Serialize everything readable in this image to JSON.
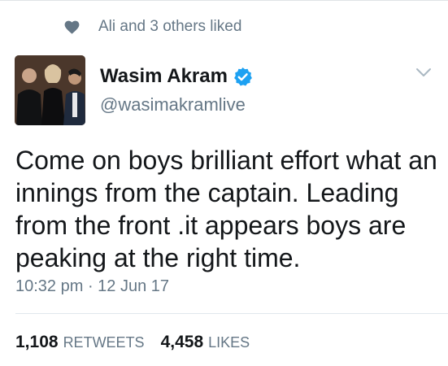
{
  "social_context": {
    "text": "Ali and 3 others liked",
    "icon": "heart-icon"
  },
  "author": {
    "display_name": "Wasim Akram",
    "handle": "@wasimakramlive",
    "verified": true,
    "verified_icon": "verified-badge-icon"
  },
  "tweet": {
    "text": "Come on boys brilliant effort what an innings from the captain. Leading from the front .it appears boys are peaking at the right time.",
    "timestamp": "10:32 pm · 12 Jun 17"
  },
  "stats": {
    "retweets_count": "1,108",
    "retweets_label": "RETWEETS",
    "likes_count": "4,458",
    "likes_label": "LIKES"
  },
  "colors": {
    "text_primary": "#14171a",
    "text_secondary": "#657786",
    "verified_blue": "#1da1f2",
    "divider": "#e1e8ed"
  }
}
